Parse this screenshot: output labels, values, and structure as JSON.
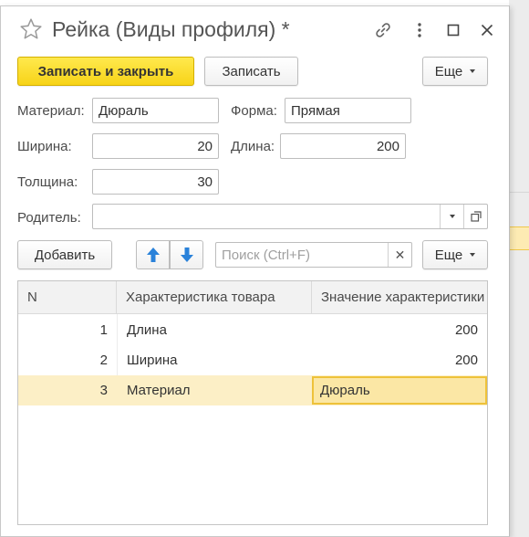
{
  "window": {
    "title": "Рейка (Виды профиля) *"
  },
  "toolbar": {
    "save_close_label": "Записать и закрыть",
    "save_label": "Записать",
    "more_label": "Еще"
  },
  "form": {
    "material_label": "Материал:",
    "material_value": "Дюраль",
    "shape_label": "Форма:",
    "shape_value": "Прямая",
    "width_label": "Ширина:",
    "width_value": "20",
    "length_label": "Длина:",
    "length_value": "200",
    "thickness_label": "Толщина:",
    "thickness_value": "30",
    "parent_label": "Родитель:",
    "parent_value": ""
  },
  "table_toolbar": {
    "add_label": "Добавить",
    "search_placeholder": "Поиск (Ctrl+F)",
    "more_label": "Еще"
  },
  "table": {
    "columns": [
      "N",
      "Характеристика товара",
      "Значение характеристики"
    ],
    "rows": [
      {
        "n": "1",
        "characteristic": "Длина",
        "value": "200"
      },
      {
        "n": "2",
        "characteristic": "Ширина",
        "value": "200"
      },
      {
        "n": "3",
        "characteristic": "Материал",
        "value": "Дюраль"
      }
    ],
    "selected_row": 3
  },
  "colors": {
    "primary_button": "#f7d318",
    "selected_row": "#fcefc6",
    "arrow_blue": "#2a82da"
  }
}
